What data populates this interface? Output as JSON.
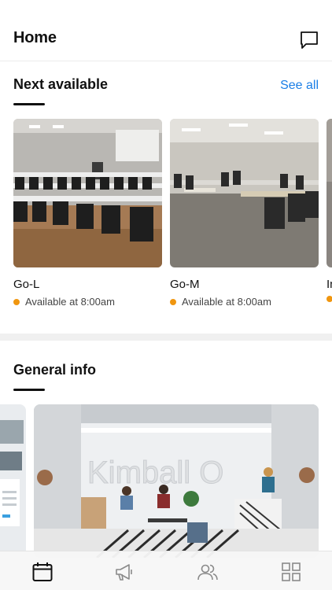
{
  "header": {
    "title": "Home",
    "chat_icon": "chat-bubble-icon"
  },
  "next_available": {
    "title": "Next available",
    "see_all": "See all",
    "cards": [
      {
        "name": "Go-L",
        "status": "Available at 8:00am"
      },
      {
        "name": "Go-M",
        "status": "Available at 8:00am"
      },
      {
        "name": "In",
        "status": ""
      }
    ]
  },
  "general_info": {
    "title": "General info",
    "banner_text": "Kimball O"
  },
  "tabbar": {
    "tabs": [
      {
        "icon": "calendar-icon",
        "active": true
      },
      {
        "icon": "megaphone-icon",
        "active": false
      },
      {
        "icon": "people-icon",
        "active": false
      },
      {
        "icon": "grid-icon",
        "active": false
      }
    ]
  },
  "colors": {
    "accent": "#1a7ee6",
    "status_dot": "#f0960f"
  }
}
